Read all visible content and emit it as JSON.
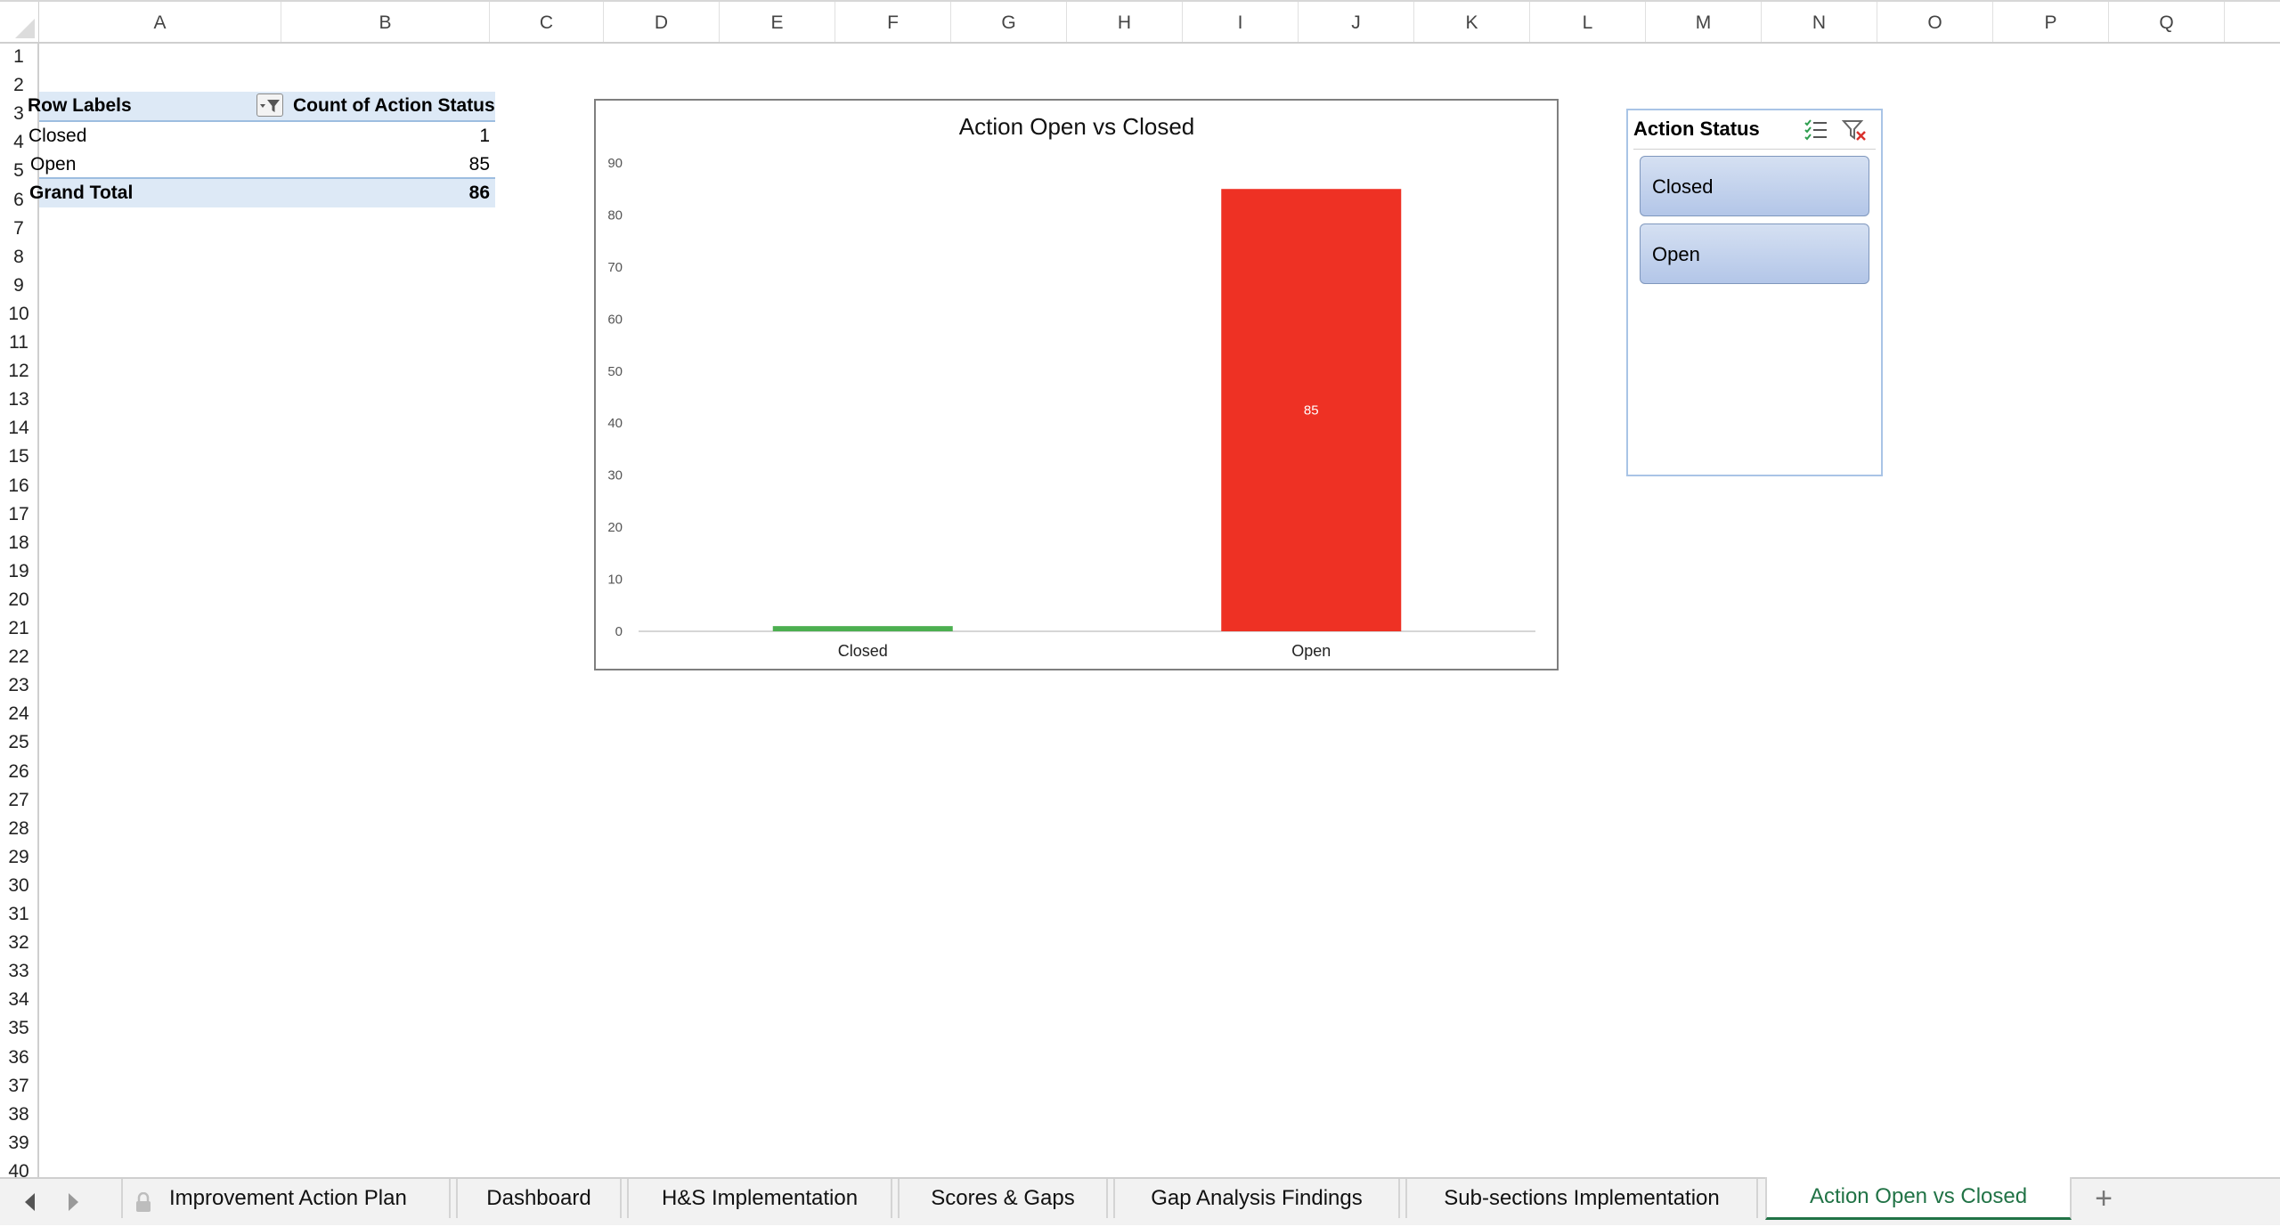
{
  "columns": [
    "A",
    "B",
    "C",
    "D",
    "E",
    "F",
    "G",
    "H",
    "I",
    "J",
    "K",
    "L",
    "M",
    "N",
    "O",
    "P",
    "Q"
  ],
  "rows": [
    "1",
    "2",
    "3",
    "4",
    "5",
    "6",
    "7",
    "8",
    "9",
    "10",
    "11",
    "12",
    "13",
    "14",
    "15",
    "16",
    "17",
    "18",
    "19",
    "20",
    "21",
    "22",
    "23",
    "24",
    "25",
    "26",
    "27",
    "28",
    "29",
    "30",
    "31",
    "32",
    "33",
    "34",
    "35",
    "36",
    "37",
    "38",
    "39",
    "40"
  ],
  "pivot": {
    "header_label": "Row Labels",
    "header_value": "Count of Action Status",
    "rows": [
      {
        "label": "Closed",
        "value": "1"
      },
      {
        "label": "Open",
        "value": "85"
      }
    ],
    "total_label": "Grand Total",
    "total_value": "86"
  },
  "chart_data": {
    "type": "bar",
    "title": "Action Open vs Closed",
    "categories": [
      "Closed",
      "Open"
    ],
    "values": [
      1,
      85
    ],
    "data_labels": [
      "",
      "85"
    ],
    "ylim": [
      0,
      90
    ],
    "yticks": [
      0,
      10,
      20,
      30,
      40,
      50,
      60,
      70,
      80,
      90
    ],
    "colors": [
      "#4caf50",
      "#ee3124"
    ],
    "grid": false,
    "legend": "none"
  },
  "slicer": {
    "title": "Action Status",
    "items": [
      "Closed",
      "Open"
    ],
    "multi_select_icon": "multi-select-icon",
    "clear_filter_icon": "clear-filter-icon"
  },
  "tabs": [
    {
      "label": "Improvement Action Plan",
      "locked": true,
      "active": false
    },
    {
      "label": "Dashboard",
      "active": false
    },
    {
      "label": "H&S Implementation",
      "active": false
    },
    {
      "label": "Scores & Gaps",
      "active": false
    },
    {
      "label": "Gap Analysis Findings",
      "active": false
    },
    {
      "label": "Sub-sections Implementation",
      "active": false
    },
    {
      "label": "Action Open vs Closed",
      "active": true
    }
  ],
  "colors": {
    "active_tab": "#217346",
    "pivot_fill": "#dde9f6",
    "slicer_fill": "#c4d4ee"
  }
}
